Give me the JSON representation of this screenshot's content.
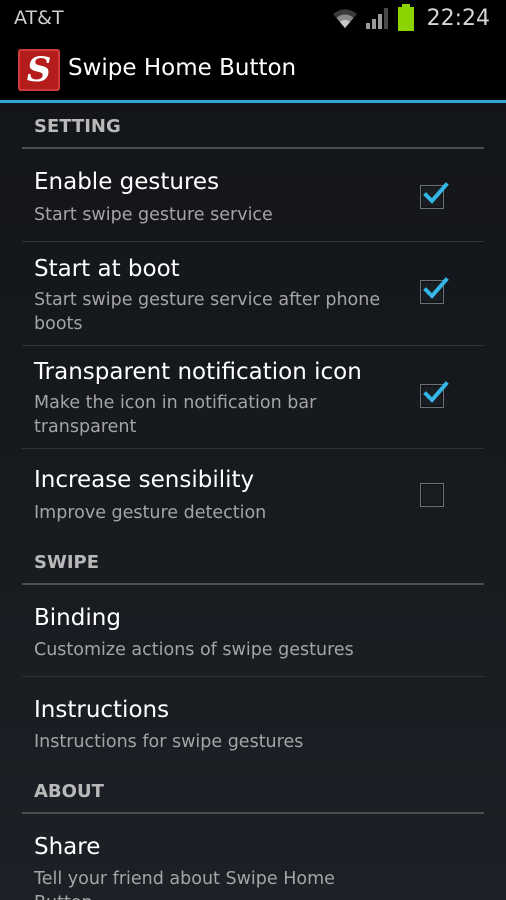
{
  "status_bar": {
    "carrier": "AT&T",
    "time": "22:24",
    "wifi_icon": "wifi-icon",
    "signal_icon": "signal-icon",
    "battery_icon": "battery-icon",
    "battery_color": "#8bd400"
  },
  "action_bar": {
    "icon_letter": "S",
    "title": "Swipe Home Button",
    "accent_color": "#33a3d6",
    "icon_color": "#b51c1c"
  },
  "categories": {
    "setting": "SETTING",
    "swipe": "SWIPE",
    "about": "ABOUT"
  },
  "setting_items": [
    {
      "title": "Enable gestures",
      "summary": "Start swipe gesture service",
      "checked": true
    },
    {
      "title": "Start at boot",
      "summary": "Start swipe gesture service after phone boots",
      "checked": true
    },
    {
      "title": "Transparent notification icon",
      "summary": "Make the icon in notification bar transparent",
      "checked": true
    },
    {
      "title": "Increase sensibility",
      "summary": "Improve gesture detection",
      "checked": false
    }
  ],
  "swipe_items": [
    {
      "title": "Binding",
      "summary": "Customize actions of swipe gestures"
    },
    {
      "title": "Instructions",
      "summary": "Instructions for swipe gestures"
    }
  ],
  "about_items": [
    {
      "title": "Share",
      "summary": "Tell your friend about Swipe Home Button"
    }
  ],
  "check_color": "#33b5e5"
}
